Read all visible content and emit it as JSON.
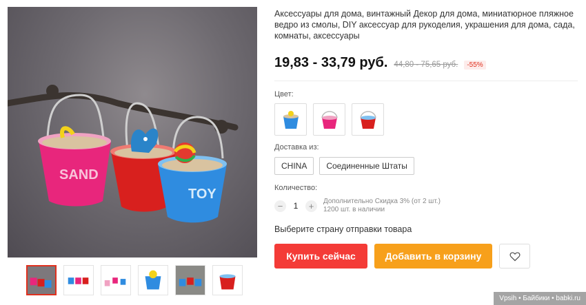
{
  "product": {
    "title": "Аксессуары для дома, винтажный Декор для дома, миниатюрное пляжное ведро из смолы, DIY аксессуар для рукоделия, украшения для дома, сада, комнаты, аксессуары",
    "price": "19,83 - 33,79 руб.",
    "old_price": "44,80 - 75,65 руб.",
    "discount": "-55%"
  },
  "image_text": {
    "bucket_pink": "SAND",
    "bucket_blue": "TOY"
  },
  "thumbnails": [
    {
      "icon": "buckets-on-branch-photo"
    },
    {
      "icon": "buckets-trio-photo"
    },
    {
      "icon": "buckets-white-photo"
    },
    {
      "icon": "blue-bucket-photo"
    },
    {
      "icon": "buckets-grey-photo"
    },
    {
      "icon": "red-bucket-photo"
    }
  ],
  "options": {
    "color_label": "Цвет:",
    "colors": [
      {
        "icon": "blue-bucket-icon"
      },
      {
        "icon": "pink-bucket-icon"
      },
      {
        "icon": "red-bucket-icon"
      }
    ],
    "shipping_label": "Доставка из:",
    "shipping": [
      "CHINA",
      "Соединенные Штаты"
    ],
    "quantity_label": "Количество:",
    "quantity_minus": "−",
    "quantity_value": "1",
    "quantity_plus": "+",
    "quantity_note_1": "Дополнительно Скидка 3% (от 2 шт.)",
    "quantity_note_2": "1200 шт. в наличии"
  },
  "ship_prompt": "Выберите страну отправки товара",
  "actions": {
    "buy": "Купить сейчас",
    "cart": "Добавить в корзину",
    "wishlist_icon": "heart-icon"
  },
  "colors": {
    "buy": "#f43b37",
    "cart": "#f7a01b",
    "discount": "#e0301e"
  },
  "watermark": "Vpsih • Байбики • babki.ru"
}
